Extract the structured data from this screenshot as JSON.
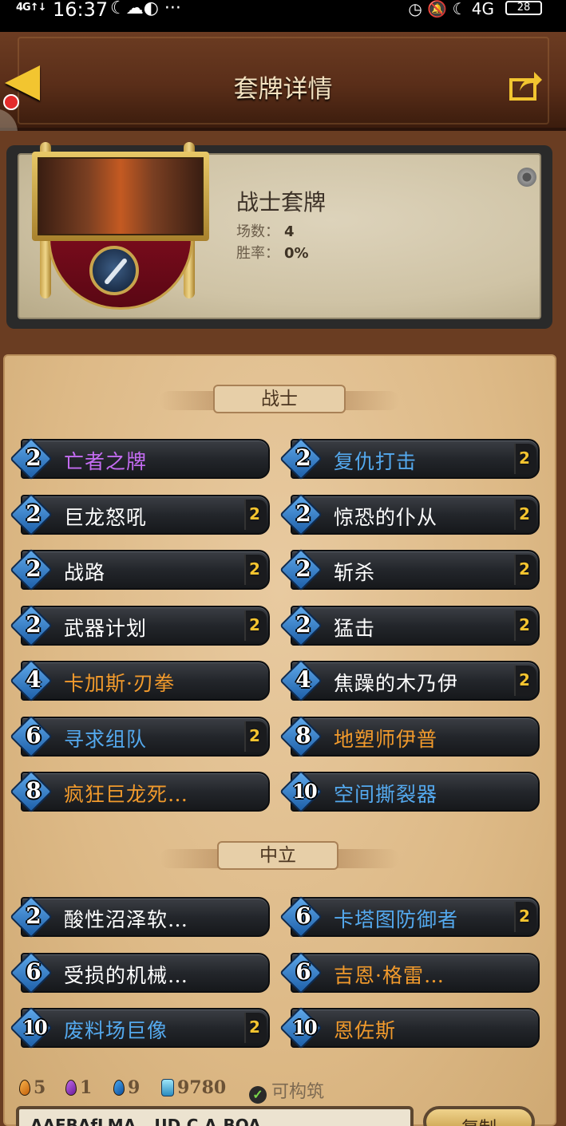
{
  "status_bar": {
    "signal": "4G↑↓",
    "time": "16:37",
    "left_icons": "☾☁◐ ···",
    "right_icons": "◷ 🔕 ☾ 4G",
    "battery": "28"
  },
  "header": {
    "title": "套牌详情",
    "back_icon": "back-arrow-icon",
    "share_icon": "share-icon"
  },
  "deck": {
    "name": "战士套牌",
    "games_label": "场数：",
    "games_value": "4",
    "winrate_label": "胜率：",
    "winrate_value": "0%"
  },
  "sections": {
    "warrior": "战士",
    "neutral": "中立"
  },
  "rarity_colors": {
    "common": "#ffffff",
    "rare": "#54a9ee",
    "epic": "#c46cf2",
    "legendary": "#f19a2c"
  },
  "warrior_cards": [
    {
      "cost": "2",
      "name": "亡者之牌",
      "rarity": "epic",
      "count": ""
    },
    {
      "cost": "2",
      "name": "复仇打击",
      "rarity": "rare",
      "count": "2"
    },
    {
      "cost": "2",
      "name": "巨龙怒吼",
      "rarity": "common",
      "count": "2"
    },
    {
      "cost": "2",
      "name": "惊恐的仆从",
      "rarity": "common",
      "count": "2"
    },
    {
      "cost": "2",
      "name": "战路",
      "rarity": "common",
      "count": "2"
    },
    {
      "cost": "2",
      "name": "斩杀",
      "rarity": "common",
      "count": "2"
    },
    {
      "cost": "2",
      "name": "武器计划",
      "rarity": "common",
      "count": "2"
    },
    {
      "cost": "2",
      "name": "猛击",
      "rarity": "common",
      "count": "2"
    },
    {
      "cost": "4",
      "name": "卡加斯·刃拳",
      "rarity": "legendary",
      "count": ""
    },
    {
      "cost": "4",
      "name": "焦躁的木乃伊",
      "rarity": "common",
      "count": "2"
    },
    {
      "cost": "6",
      "name": "寻求组队",
      "rarity": "rare",
      "count": "2"
    },
    {
      "cost": "8",
      "name": "地塑师伊普",
      "rarity": "legendary",
      "count": ""
    },
    {
      "cost": "8",
      "name": "疯狂巨龙死…",
      "rarity": "legendary",
      "count": ""
    },
    {
      "cost": "10",
      "name": "空间撕裂器",
      "rarity": "rare",
      "count": ""
    }
  ],
  "neutral_cards": [
    {
      "cost": "2",
      "name": "酸性沼泽软…",
      "rarity": "common",
      "count": ""
    },
    {
      "cost": "6",
      "name": "卡塔图防御者",
      "rarity": "rare",
      "count": "2"
    },
    {
      "cost": "6",
      "name": "受损的机械…",
      "rarity": "common",
      "count": ""
    },
    {
      "cost": "6",
      "name": "吉恩·格雷…",
      "rarity": "legendary",
      "count": ""
    },
    {
      "cost": "10",
      "name": "废料场巨像",
      "rarity": "rare",
      "count": "2"
    },
    {
      "cost": "10",
      "name": "恩佐斯",
      "rarity": "legendary",
      "count": ""
    }
  ],
  "footer": {
    "legendary_count": "5",
    "epic_count": "1",
    "rare_count": "9",
    "dust": "9780",
    "buildable": "可构筑"
  },
  "deck_code": "AAEBAfLMA...UD,C,A,BOA",
  "copy_button": "复制"
}
